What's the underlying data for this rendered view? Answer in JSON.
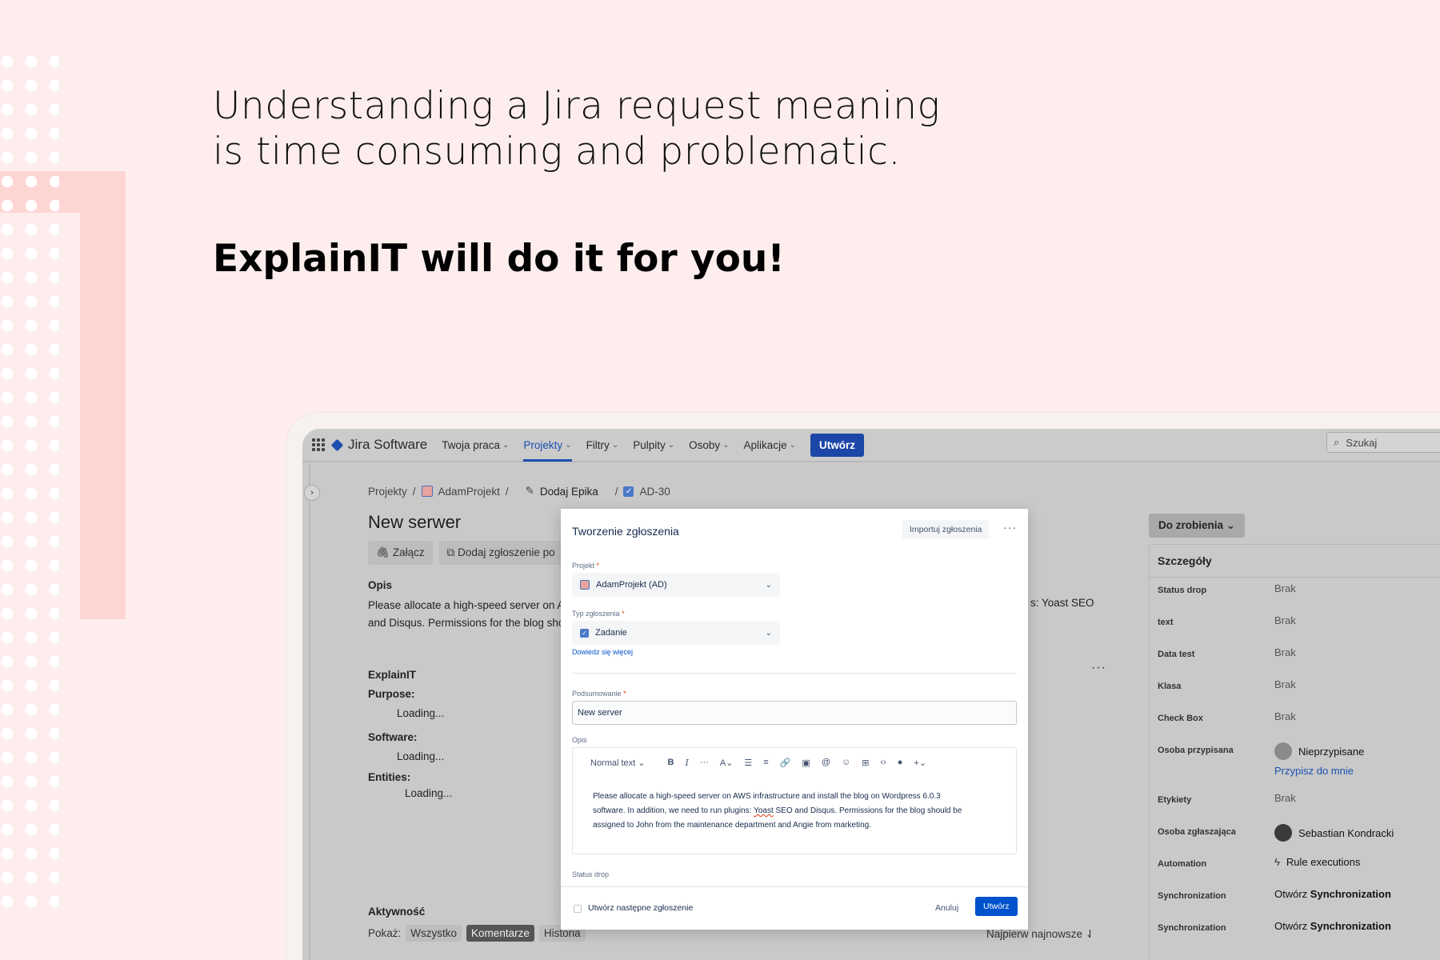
{
  "hero": {
    "line1": "Understanding a Jira request meaning",
    "line2": "is time consuming and problematic.",
    "tagline": "ExplainIT will do it for you!"
  },
  "topnav": {
    "brand": "Jira Software",
    "items": [
      "Twoja praca",
      "Projekty",
      "Filtry",
      "Pulpity",
      "Osoby",
      "Aplikacje"
    ],
    "active": "Projekty",
    "create_label": "Utwórz",
    "search_placeholder": "Szukaj"
  },
  "breadcrumb": {
    "projects": "Projekty",
    "project": "AdamProjekt",
    "epic": "Dodaj Epika",
    "issue_key": "AD-30"
  },
  "issue": {
    "title": "New serwer",
    "attach_label": "Załącz",
    "add_child_label": "Dodaj zgłoszenie po",
    "description_label": "Opis",
    "description_line1": "Please allocate a high-speed server on AW",
    "description_line2": "and Disqus. Permissions for the blog shou",
    "description_tail": "s: Yoast SEO"
  },
  "explainit": {
    "title": "ExplainIT",
    "purpose_label": "Purpose:",
    "software_label": "Software:",
    "entities_label": "Entities:",
    "loading": "Loading..."
  },
  "activity": {
    "title": "Aktywność",
    "show_label": "Pokaż:",
    "filters": [
      "Wszystko",
      "Komentarze",
      "Historia"
    ],
    "selected_filter": "Komentarze",
    "sort_label": "Najpierw najnowsze"
  },
  "side_panel": {
    "status_button": "Do zrobienia",
    "details_title": "Szczegóły",
    "rows": [
      {
        "key": "Status drop",
        "value": "Brak"
      },
      {
        "key": "text",
        "value": "Brak"
      },
      {
        "key": "Data test",
        "value": "Brak"
      },
      {
        "key": "Klasa",
        "value": "Brak"
      },
      {
        "key": "Check Box",
        "value": "Brak"
      }
    ],
    "assignee_label": "Osoba przypisana",
    "assignee_value": "Nieprzypisane",
    "assign_to_me": "Przypisz do mnie",
    "labels_label": "Etykiety",
    "labels_value": "Brak",
    "reporter_label": "Osoba zgłaszająca",
    "reporter_value": "Sebastian Kondracki",
    "automation_label": "Automation",
    "automation_value": "Rule executions",
    "sync_label": "Synchronization",
    "sync_prefix": "Otwórz",
    "sync_bold": "Synchronization"
  },
  "modal": {
    "title": "Tworzenie zgłoszenia",
    "import_label": "Importuj zgłoszenia",
    "project_label": "Projekt",
    "project_value": "AdamProjekt (AD)",
    "type_label": "Typ zgłoszenia",
    "type_value": "Zadanie",
    "learn_more": "Dowiedz się więcej",
    "summary_label": "Podsumowanie",
    "summary_value": "New server",
    "description_label": "Opis",
    "text_style": "Normal text",
    "desc_line1": "Please allocate a high-speed server on AWS infrastructure and install the blog on Wordpress 6.0.3",
    "desc_line2_a": "software. In addition, we need to run plugins: ",
    "desc_line2_b": "Yoast",
    "desc_line2_c": " SEO and Disqus. Permissions for the blog should be",
    "desc_line3": "assigned to John from the maintenance department and Angie from marketing.",
    "status_drop_label": "Status drop",
    "create_another": "Utwórz następne zgłoszenie",
    "cancel": "Anuluj",
    "submit": "Utwórz"
  }
}
